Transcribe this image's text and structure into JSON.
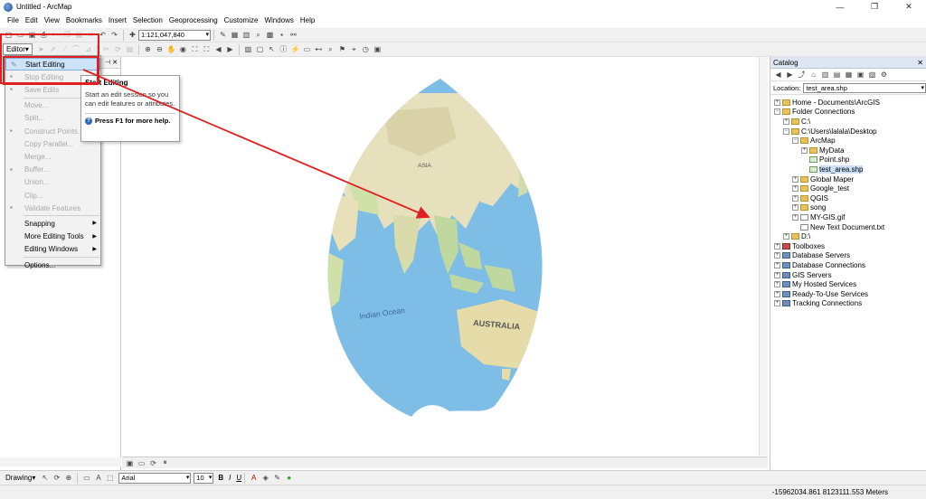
{
  "window": {
    "title": "Untitled - ArcMap",
    "min_glyph": "—",
    "max_glyph": "❐",
    "close_glyph": "✕"
  },
  "menubar": [
    "File",
    "Edit",
    "View",
    "Bookmarks",
    "Insert",
    "Selection",
    "Geoprocessing",
    "Customize",
    "Windows",
    "Help"
  ],
  "toolbar": {
    "scale_value": "1:121,047,840",
    "editor_label": "Editor▾"
  },
  "editor_menu": {
    "items": [
      {
        "label": "Start Editing",
        "state": "highlighted",
        "icon": "pencil-icon"
      },
      {
        "label": "Stop Editing",
        "state": "disabled",
        "icon": "stop-editing-icon"
      },
      {
        "label": "Save Edits",
        "state": "disabled",
        "icon": "save-edits-icon"
      },
      {
        "label": "Move...",
        "state": "disabled"
      },
      {
        "label": "Split...",
        "state": "disabled"
      },
      {
        "label": "Construct Points...",
        "state": "disabled",
        "icon": "construct-points-icon"
      },
      {
        "label": "Copy Parallel...",
        "state": "disabled"
      },
      {
        "label": "Merge...",
        "state": "disabled"
      },
      {
        "label": "Buffer...",
        "state": "disabled",
        "icon": "buffer-icon"
      },
      {
        "label": "Union...",
        "state": "disabled"
      },
      {
        "label": "Clip...",
        "state": "disabled"
      },
      {
        "label": "Validate Features",
        "state": "disabled",
        "icon": "validate-icon"
      },
      {
        "label": "Snapping",
        "state": "enabled",
        "submenu": true
      },
      {
        "label": "More Editing Tools",
        "state": "enabled",
        "submenu": true
      },
      {
        "label": "Editing Windows",
        "state": "enabled",
        "submenu": true
      },
      {
        "label": "Options...",
        "state": "enabled"
      }
    ]
  },
  "tooltip": {
    "title": "Start Editing",
    "body": "Start an edit session so you can edit features or attributes.",
    "help": "Press F1 for more help."
  },
  "map": {
    "labels": {
      "asia": "ASIA",
      "indian_ocean": "Indian Ocean",
      "australia": "AUSTRALIA"
    }
  },
  "catalog": {
    "title": "Catalog",
    "location_label": "Location:",
    "location_value": "test_area.shp",
    "tree": [
      {
        "label": "Home - Documents\\ArcGIS",
        "level": 0,
        "exp": "+",
        "icon": "folder"
      },
      {
        "label": "Folder Connections",
        "level": 0,
        "exp": "−",
        "icon": "folder"
      },
      {
        "label": "C:\\",
        "level": 1,
        "exp": "+",
        "icon": "folder"
      },
      {
        "label": "C:\\Users\\lalala\\Desktop",
        "level": 1,
        "exp": "−",
        "icon": "folder"
      },
      {
        "label": "ArcMap",
        "level": 2,
        "exp": "−",
        "icon": "folder"
      },
      {
        "label": "MyData",
        "level": 3,
        "exp": "+",
        "icon": "folder"
      },
      {
        "label": "Point.shp",
        "level": 3,
        "exp": "",
        "icon": "shp"
      },
      {
        "label": "test_area.shp",
        "level": 3,
        "exp": "",
        "icon": "shp",
        "selected": true
      },
      {
        "label": "Global Maper",
        "level": 2,
        "exp": "+",
        "icon": "folder"
      },
      {
        "label": "Google_test",
        "level": 2,
        "exp": "+",
        "icon": "folder"
      },
      {
        "label": "QGIS",
        "level": 2,
        "exp": "+",
        "icon": "folder"
      },
      {
        "label": "song",
        "level": 2,
        "exp": "+",
        "icon": "folder"
      },
      {
        "label": "MY-GIS.gif",
        "level": 2,
        "exp": "+",
        "icon": "doc"
      },
      {
        "label": "New Text Document.txt",
        "level": 2,
        "exp": "",
        "icon": "doc"
      },
      {
        "label": "D:\\",
        "level": 1,
        "exp": "+",
        "icon": "folder"
      },
      {
        "label": "Toolboxes",
        "level": 0,
        "exp": "+",
        "icon": "tool"
      },
      {
        "label": "Database Servers",
        "level": 0,
        "exp": "+",
        "icon": "server"
      },
      {
        "label": "Database Connections",
        "level": 0,
        "exp": "+",
        "icon": "server"
      },
      {
        "label": "GIS Servers",
        "level": 0,
        "exp": "+",
        "icon": "server"
      },
      {
        "label": "My Hosted Services",
        "level": 0,
        "exp": "+",
        "icon": "server"
      },
      {
        "label": "Ready-To-Use Services",
        "level": 0,
        "exp": "+",
        "icon": "server"
      },
      {
        "label": "Tracking Connections",
        "level": 0,
        "exp": "+",
        "icon": "server"
      }
    ]
  },
  "drawing_toolbar": {
    "drawing_label": "Drawing▾",
    "font_name": "Arial",
    "font_size": "10",
    "bold": "B",
    "italic": "I",
    "underline": "U"
  },
  "status": {
    "coordinates": "-15962034.861  8123111.553 Meters"
  },
  "colors": {
    "annotation_red": "#e02020",
    "ocean": "#79b8e4",
    "land": "#e8e2c0",
    "highlight": "#cde3fa"
  }
}
